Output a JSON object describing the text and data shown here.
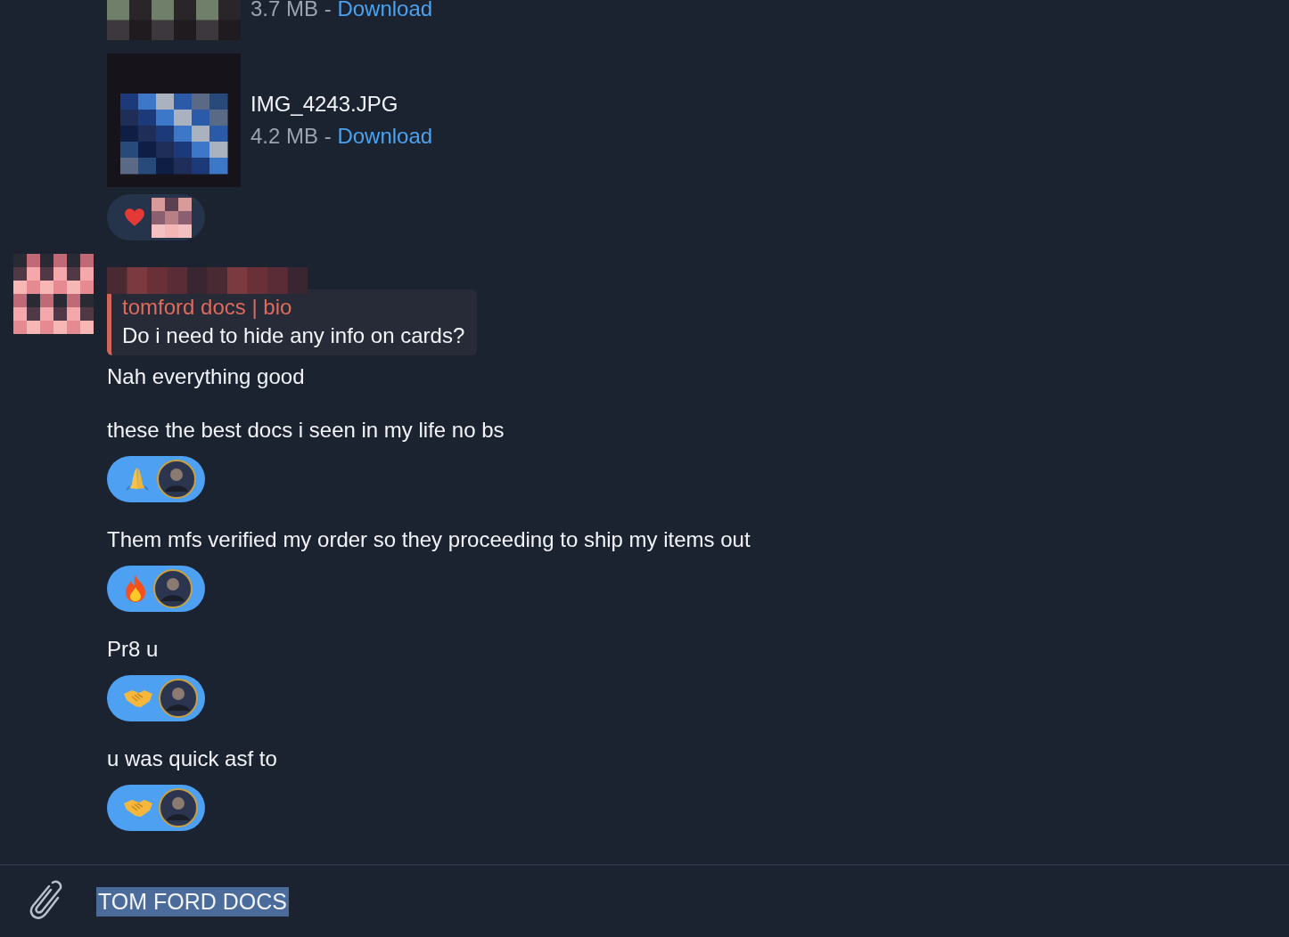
{
  "files": [
    {
      "size": "3.7 MB",
      "separator": "-",
      "action": "Download"
    },
    {
      "name": "IMG_4243.JPG",
      "size": "4.2 MB",
      "separator": "-",
      "action": "Download"
    }
  ],
  "file_reactions": [
    {
      "kind": "heart",
      "selected": false
    }
  ],
  "sender_message": {
    "reply": {
      "author": "tomford docs | bio",
      "text": "Do i need to hide any info on cards?"
    },
    "messages": [
      {
        "text": "Nah everything good"
      },
      {
        "text": "these the best docs i seen in my life no bs",
        "reactions": [
          {
            "kind": "pray",
            "selected": true
          }
        ]
      },
      {
        "text": "Them mfs verified my order so they proceeding to ship my items out",
        "reactions": [
          {
            "kind": "fire",
            "selected": true
          }
        ]
      },
      {
        "text": "Pr8 u",
        "reactions": [
          {
            "kind": "handshake",
            "selected": true
          }
        ]
      },
      {
        "text": "u was quick asf to",
        "reactions": [
          {
            "kind": "handshake",
            "selected": true
          }
        ]
      }
    ]
  },
  "composer": {
    "value": "TOM FORD DOCS",
    "selected": true
  }
}
